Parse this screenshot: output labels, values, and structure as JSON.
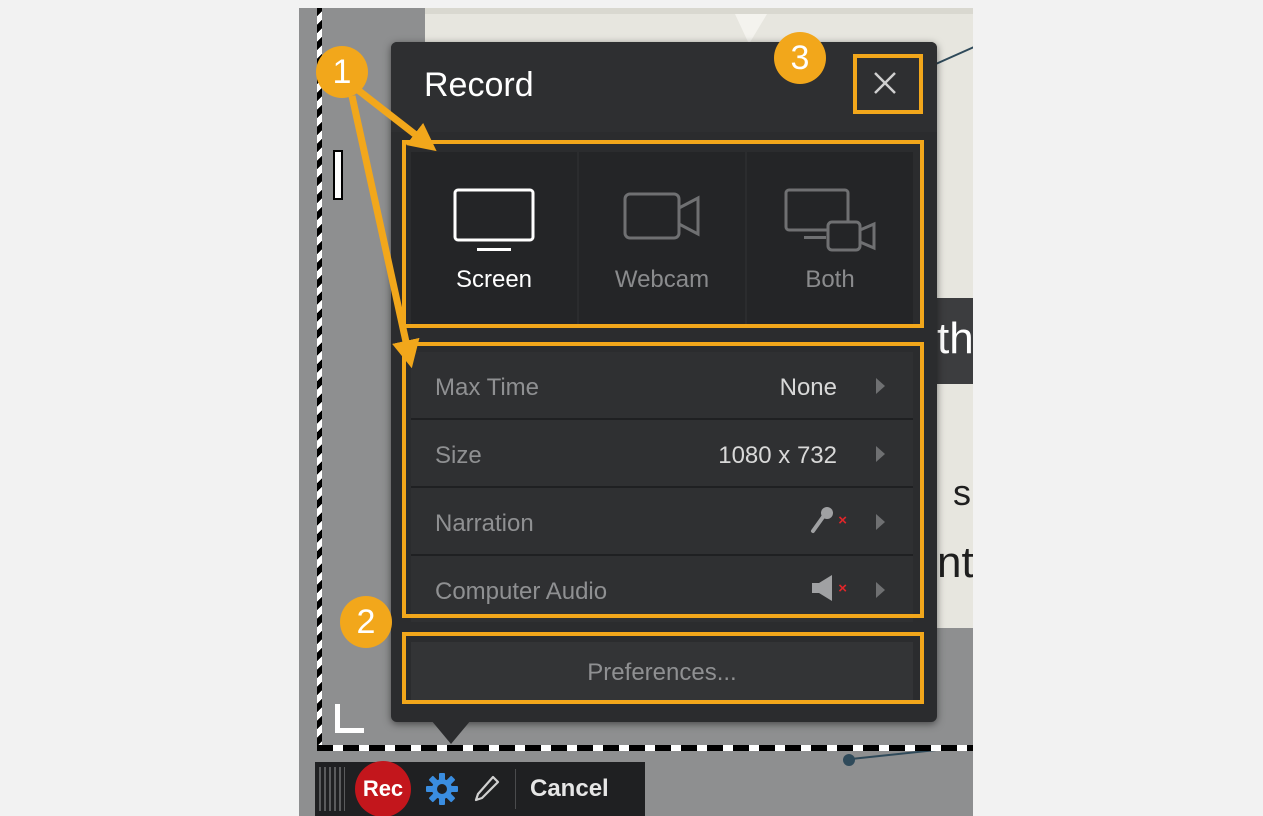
{
  "panel": {
    "title": "Record",
    "close_label": "×"
  },
  "modes": [
    {
      "label": "Screen",
      "icon": "monitor-icon",
      "active": true
    },
    {
      "label": "Webcam",
      "icon": "webcam-icon",
      "active": false
    },
    {
      "label": "Both",
      "icon": "screen-and-webcam-icon",
      "active": false
    }
  ],
  "settings": [
    {
      "key": "Max Time",
      "value": "None"
    },
    {
      "key": "Size",
      "value": "1080 x 732"
    },
    {
      "key": "Narration",
      "icon": "microphone-muted-icon"
    },
    {
      "key": "Computer Audio",
      "icon": "speaker-muted-icon"
    }
  ],
  "preferences_label": "Preferences...",
  "toolbar": {
    "rec_label": "Rec",
    "cancel_label": "Cancel"
  },
  "callouts": [
    "1",
    "2",
    "3"
  ],
  "background_text": {
    "a": "th",
    "b": "s",
    "c": "nt"
  },
  "colors": {
    "highlight": "#f2a71b",
    "rec": "#c3161c",
    "gear": "#3a8de0",
    "mute_x": "#e0262a"
  }
}
